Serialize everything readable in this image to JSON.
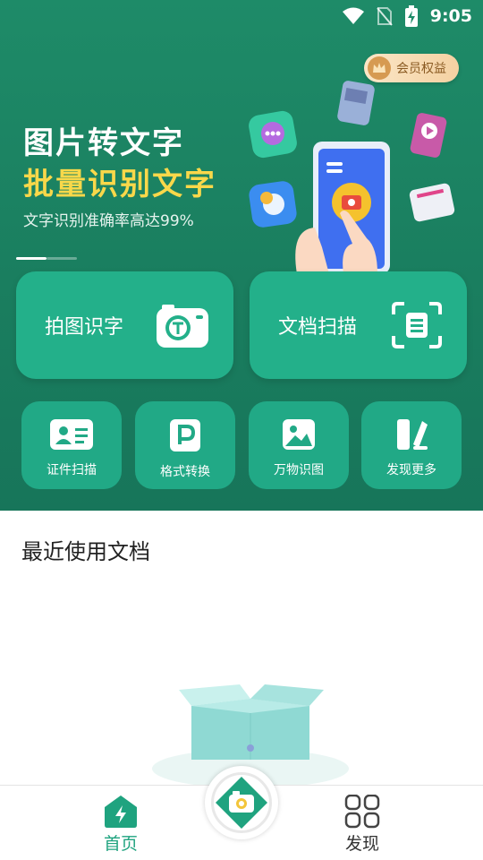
{
  "status_bar": {
    "time": "9:05"
  },
  "vip": {
    "label": "会员权益"
  },
  "banner": {
    "title_line1": "图片转文字",
    "title_line2": "批量识别文字",
    "subtitle": "文字识别准确率高达99%"
  },
  "main_actions": [
    {
      "label": "拍图识字",
      "icon": "camera-t-icon"
    },
    {
      "label": "文档扫描",
      "icon": "scan-doc-icon"
    }
  ],
  "tools": [
    {
      "label": "证件扫描",
      "icon": "id-card-icon"
    },
    {
      "label": "格式转换",
      "icon": "format-p-icon"
    },
    {
      "label": "万物识图",
      "icon": "image-icon"
    },
    {
      "label": "发现更多",
      "icon": "more-tools-icon"
    }
  ],
  "recent": {
    "title": "最近使用文档"
  },
  "bottom_nav": {
    "home": "首页",
    "discover": "发现"
  },
  "colors": {
    "hero_green": "#1e8b68",
    "card_green": "#23b08a",
    "accent_yellow": "#f9d84a",
    "nav_active": "#1fa37f"
  }
}
